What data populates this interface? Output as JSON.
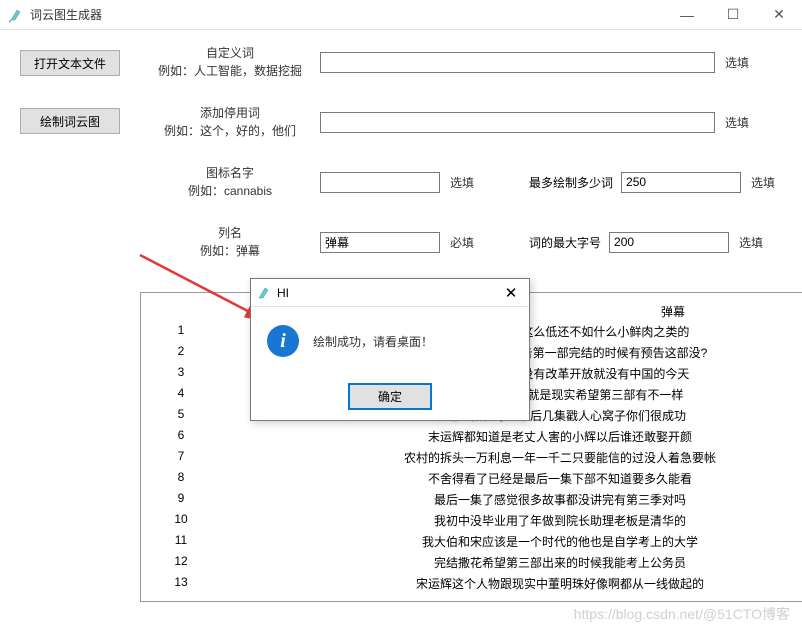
{
  "window": {
    "title": "词云图生成器",
    "controls": {
      "min": "—",
      "max": "☐",
      "close": "✕"
    }
  },
  "buttons": {
    "open_file": "打开文本文件",
    "draw": "绘制词云图"
  },
  "form": {
    "custom_words": {
      "label": "自定义词",
      "sub": "例如：人工智能，数据挖掘",
      "value": "",
      "hint": "选填"
    },
    "stop_words": {
      "label": "添加停用词",
      "sub": "例如：这个，好的，他们",
      "value": "",
      "hint": "选填"
    },
    "icon_name": {
      "label": "图标名字",
      "sub": "例如：cannabis",
      "value": "",
      "hint": "选填"
    },
    "max_words": {
      "label": "最多绘制多少词",
      "value": "250",
      "hint": "选填"
    },
    "col_name": {
      "label": "列名",
      "sub": "例如：弹幕",
      "value": "弹幕",
      "hint": "必填"
    },
    "max_font": {
      "label": "词的最大字号",
      "value": "200",
      "hint": "选填"
    }
  },
  "table": {
    "header": "弹幕",
    "rows": [
      {
        "n": "1",
        "text": "?的剧怎么播放量这么低还不如什么小鲜肉之类的"
      },
      {
        "n": "2",
        "text": "第三部了因为没有预告第一部完结的时候有预告这部没?"
      },
      {
        "n": "3",
        "text": "?中国人一定记住没有改革开放就没有中国的今天"
      },
      {
        "n": "4",
        "text": "?结局不如意但这就是现实希望第三部有不一样"
      },
      {
        "n": "5",
        "text": "平铺直叙就等到最后几集戳人心窝子你们很成功"
      },
      {
        "n": "6",
        "text": "末运辉都知道是老丈人害的小辉以后谁还敢娶开颜"
      },
      {
        "n": "7",
        "text": "农村的拆头一万利息一年一千二只要能信的过没人着急要帐"
      },
      {
        "n": "8",
        "text": "不舍得看了已经是最后一集下部不知道要多久能看"
      },
      {
        "n": "9",
        "text": "最后一集了感觉很多故事都没讲完有第三季对吗"
      },
      {
        "n": "10",
        "text": "我初中没毕业用了年做到院长助理老板是清华的"
      },
      {
        "n": "11",
        "text": "我大伯和宋应该是一个时代的他也是自学考上的大学"
      },
      {
        "n": "12",
        "text": "完结撒花希望第三部出来的时候我能考上公务员"
      },
      {
        "n": "13",
        "text": "宋运辉这个人物跟现实中董明珠好像啊都从一线做起的"
      }
    ]
  },
  "modal": {
    "title": "HI",
    "message": "绘制成功，请看桌面！",
    "ok": "确定",
    "close": "✕"
  },
  "watermark": "https://blog.csdn.net/@51CTO博客"
}
